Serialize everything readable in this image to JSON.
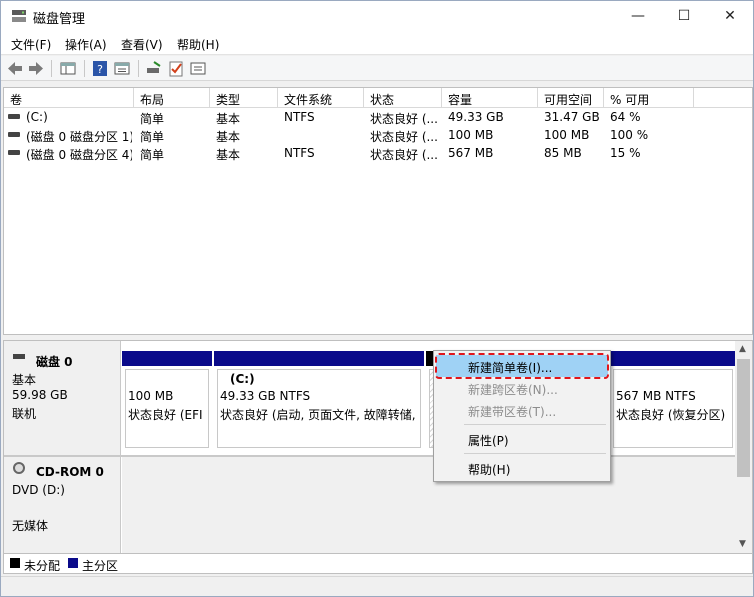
{
  "window": {
    "title": "磁盘管理",
    "controls": {
      "minimize": "—",
      "maximize": "☐",
      "close": "✕"
    }
  },
  "menu": {
    "items": [
      "文件(F)",
      "操作(A)",
      "查看(V)",
      "帮助(H)"
    ]
  },
  "toolbar": {
    "icons": [
      "back-arrow-icon",
      "forward-arrow-icon",
      "console-tree-icon",
      "help-icon",
      "properties-icon",
      "connect-icon",
      "check-icon",
      "list-icon"
    ]
  },
  "volume_list": {
    "columns": [
      "卷",
      "布局",
      "类型",
      "文件系统",
      "状态",
      "容量",
      "可用空间",
      "% 可用"
    ],
    "rows": [
      [
        "(C:)",
        "简单",
        "基本",
        "NTFS",
        "状态良好 (...",
        "49.33 GB",
        "31.47 GB",
        "64 %"
      ],
      [
        "(磁盘 0 磁盘分区 1)",
        "简单",
        "基本",
        "",
        "状态良好 (...",
        "100 MB",
        "100 MB",
        "100 %"
      ],
      [
        "(磁盘 0 磁盘分区 4)",
        "简单",
        "基本",
        "NTFS",
        "状态良好 (...",
        "567 MB",
        "85 MB",
        "15 %"
      ]
    ]
  },
  "disks": {
    "disk0": {
      "name": "磁盘 0",
      "type": "基本",
      "size": "59.98 GB",
      "status": "联机",
      "partitions": [
        {
          "title": "",
          "line1": "100 MB",
          "line2": "状态良好 (EFI"
        },
        {
          "title": "(C:)",
          "line1": "49.33 GB NTFS",
          "line2": "状态良好 (启动, 页面文件, 故障转储,"
        },
        {
          "title": "",
          "line1": "",
          "line2": ""
        },
        {
          "title": "",
          "line1": "567 MB NTFS",
          "line2": "状态良好 (恢复分区)"
        }
      ]
    },
    "cdrom0": {
      "name": "CD-ROM 0",
      "drive": "DVD (D:)",
      "status": "无媒体"
    }
  },
  "legend": {
    "unallocated": "未分配",
    "primary": "主分区",
    "colors": {
      "unallocated": "#000000",
      "primary": "#0a0a8a"
    }
  },
  "context_menu": {
    "items": [
      {
        "label": "新建简单卷(I)...",
        "enabled": true,
        "highlighted": true
      },
      {
        "label": "新建跨区卷(N)...",
        "enabled": false
      },
      {
        "label": "新建带区卷(T)...",
        "enabled": false
      },
      {
        "label": "属性(P)",
        "enabled": true
      },
      {
        "label": "帮助(H)",
        "enabled": true
      }
    ]
  }
}
